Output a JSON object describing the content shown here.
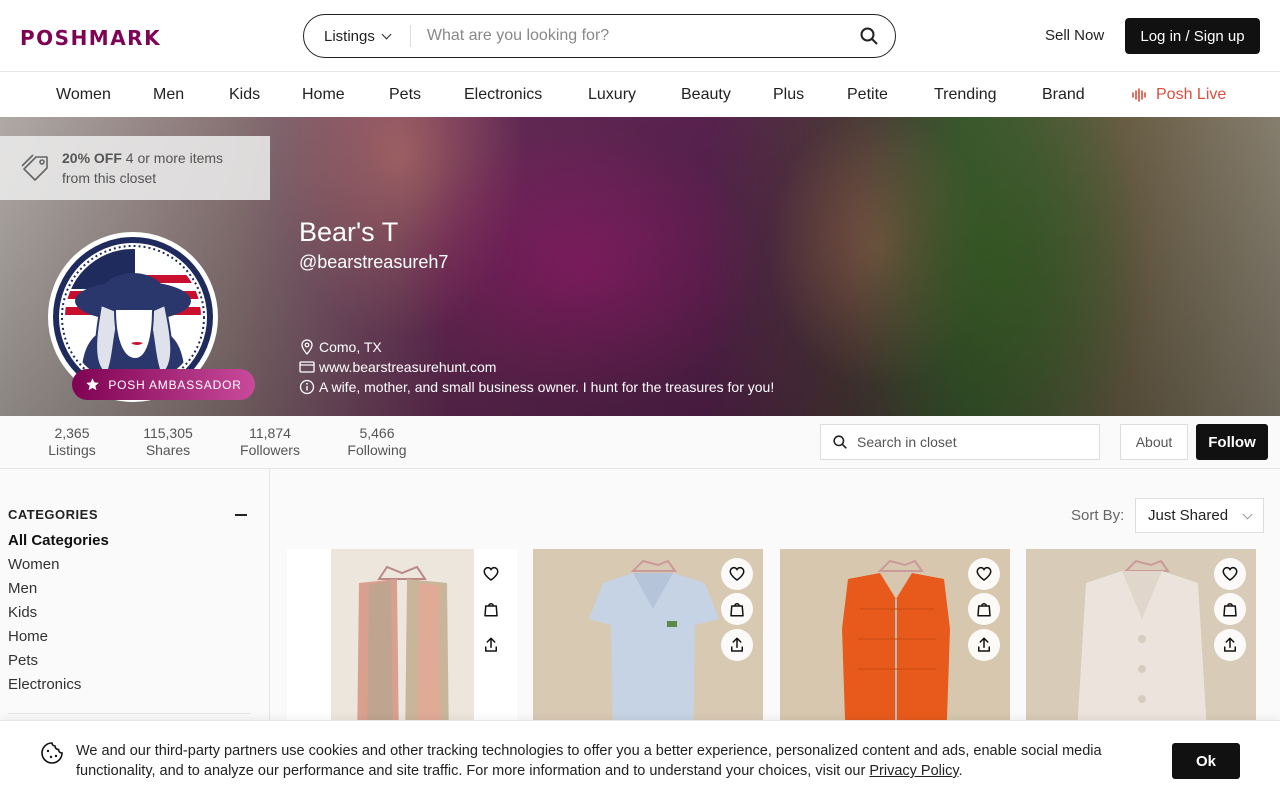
{
  "brand": {
    "logo_text": "POSHMARK",
    "accent": "#7f0353"
  },
  "header": {
    "search_type": "Listings",
    "search_placeholder": "What are you looking for?",
    "sell_now": "Sell Now",
    "login": "Log in / Sign up"
  },
  "nav": {
    "items": [
      "Women",
      "Men",
      "Kids",
      "Home",
      "Pets",
      "Electronics",
      "Luxury",
      "Beauty",
      "Plus",
      "Petite",
      "Trending",
      "Brand"
    ],
    "posh_live": "Posh Live",
    "posh_live_color": "#d94f3f"
  },
  "promo": {
    "bold": "20% OFF",
    "rest": " 4 or more items from this closet"
  },
  "profile": {
    "name": "Bear's T",
    "handle": "@bearstreasureh7",
    "badge": "POSH AMBASSADOR",
    "location": "Como, TX",
    "website": "www.bearstreasurehunt.com",
    "bio": "A wife, mother, and small business owner. I hunt for the treasures for you!"
  },
  "stats": [
    {
      "value": "2,365",
      "label": "Listings"
    },
    {
      "value": "115,305",
      "label": "Shares"
    },
    {
      "value": "11,874",
      "label": "Followers"
    },
    {
      "value": "5,466",
      "label": "Following"
    }
  ],
  "closet_search_placeholder": "Search in closet",
  "about_label": "About",
  "follow_label": "Follow",
  "sidebar": {
    "title": "CATEGORIES",
    "items": [
      "All Categories",
      "Women",
      "Men",
      "Kids",
      "Home",
      "Pets",
      "Electronics"
    ]
  },
  "sort": {
    "label": "Sort By:",
    "value": "Just Shared"
  },
  "cookie": {
    "text": "We and our third-party partners use cookies and other tracking technologies to offer you a better experience, personalized content and ads, enable social media functionality, and to analyze our performance and site traffic. For more information and to understand your choices, visit our ",
    "link": "Privacy Policy",
    "end": ".",
    "ok": "Ok"
  }
}
